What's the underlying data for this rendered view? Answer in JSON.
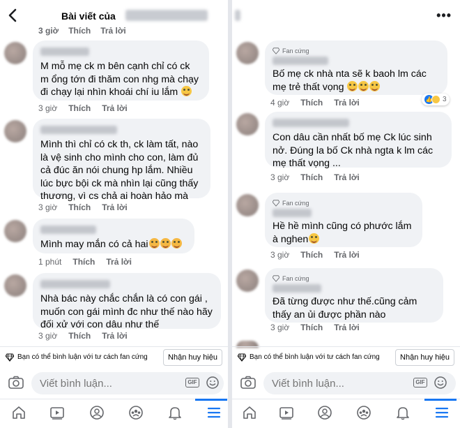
{
  "left": {
    "header": {
      "back_icon": "chevron-left-icon",
      "title": "Bài viết của"
    },
    "partial_meta": {
      "time": "3 giờ",
      "like": "Thích",
      "reply": "Trả lời"
    },
    "comments": [
      {
        "text": "M mỗ mẹ ck m bên cạnh chỉ có ck m ổng tớn đi thăm con nhg mà chạy đi chạy lại nhìn khoái chí iu lắm",
        "emoji": "grinning-face-tongue",
        "time": "3 giờ",
        "like": "Thích",
        "reply": "Trả lời"
      },
      {
        "text": "Mình thì chỉ có ck th, ck làm tất, nào là vệ sinh cho mình cho con, làm đủ cả đúc ăn  nói chung hp lắm. Nhiều lúc bực bội ck mà nhìn lại cũng thấy thương, vì cs chả ai hoàn hảo mà",
        "time": "3 giờ",
        "like": "Thích",
        "reply": "Trả lời"
      },
      {
        "text": "Mình may mắn có cả hai",
        "emoji": "smiling-face-hearts x3",
        "time": "1 phút",
        "like": "Thích",
        "reply": "Trả lời"
      },
      {
        "text": "Nhà bác này chắc chắn là có con gái , muốn con gái mình đc như thế nào hãy đối xử với con dâu như thế",
        "time": "3 giờ",
        "like": "Thích",
        "reply": "Trả lời"
      }
    ],
    "fan_bar": {
      "icon": "diamond-icon",
      "text": "Bạn có thể bình luận với tư cách fan cứng",
      "button": "Nhận huy hiệu"
    },
    "input": {
      "placeholder": "Viết bình luận...",
      "camera_icon": "camera-icon",
      "gif_label": "GIF",
      "emoji_icon": "smiley-icon"
    },
    "nav": [
      "home-icon",
      "watch-icon",
      "profile-icon",
      "groups-icon",
      "bell-icon",
      "menu-icon"
    ]
  },
  "right": {
    "header": {
      "more_icon": "more-dots-icon",
      "more_label": "•••"
    },
    "comments": [
      {
        "badge": "Fan cứng",
        "text": "Bố mẹ ck nhà nta sẽ k baoh lm các mẹ trẻ thất vọng",
        "emoji": "grinning-face x3",
        "time": "4 giờ",
        "like": "Thích",
        "reply": "Trả lời",
        "reaction_count": "3"
      },
      {
        "text": "Con dâu cần nhất bố mẹ Ck lúc  sinh nở. Đúng la bố Ck nhà ngta k lm các mẹ thất vọng ...",
        "time": "3 giờ",
        "like": "Thích",
        "reply": "Trả lời"
      },
      {
        "badge": "Fan cứng",
        "text": "Hề hề mình cũng có phước lắm à nghen",
        "emoji": "smiling-face",
        "time": "3 giờ",
        "like": "Thích",
        "reply": "Trả lời"
      },
      {
        "badge": "Fan cứng",
        "text": "Đã từng được như thế.cũng cảm thấy an ủi được phần nào",
        "time": "3 giờ",
        "like": "Thích",
        "reply": "Trả lời"
      }
    ],
    "fan_bar": {
      "icon": "diamond-icon",
      "text": "Bạn có thể bình luận với tư cách fan cứng",
      "button": "Nhận huy hiệu"
    },
    "input": {
      "placeholder": "Viết bình luận...",
      "camera_icon": "camera-icon",
      "gif_label": "GIF",
      "emoji_icon": "smiley-icon"
    },
    "nav": [
      "home-icon",
      "watch-icon",
      "profile-icon",
      "groups-icon",
      "bell-icon",
      "menu-icon"
    ]
  },
  "colors": {
    "bubble": "#f0f2f5",
    "meta": "#65676b",
    "accent": "#1877f2"
  }
}
